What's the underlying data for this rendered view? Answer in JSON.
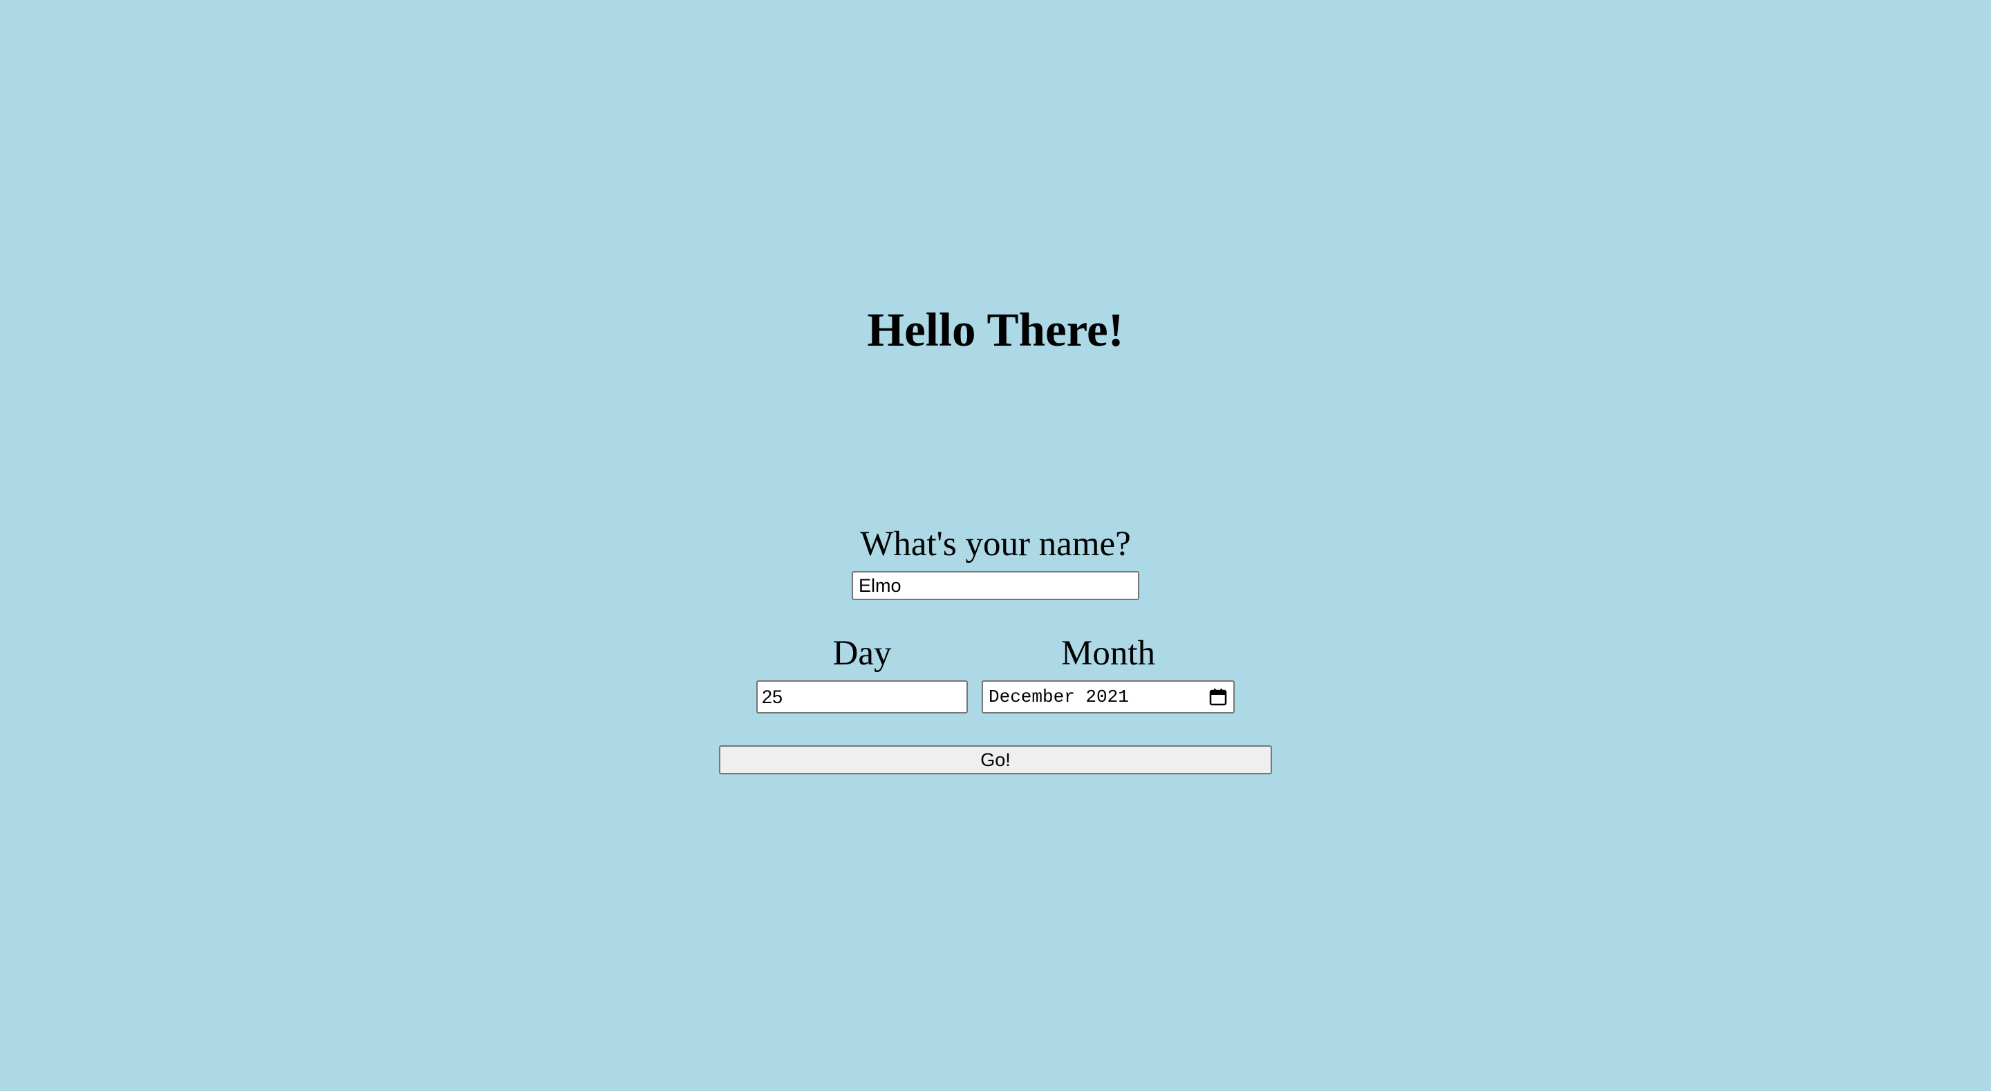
{
  "page": {
    "background_color": "#add8e6",
    "title": "Hello There!"
  },
  "form": {
    "name_label": "What's your name?",
    "name_value": "Elmo",
    "day_label": "Day",
    "day_value": "25",
    "month_label": "Month",
    "month_value": "December 2021",
    "month_picker_icon": "calendar-icon",
    "submit_label": "Go!"
  }
}
